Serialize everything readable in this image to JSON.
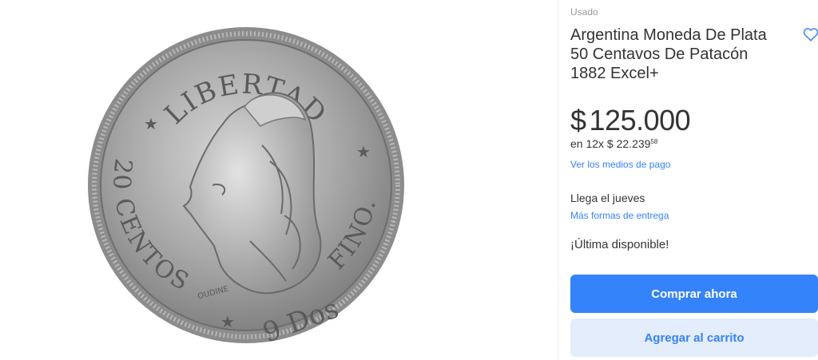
{
  "product": {
    "condition": "Usado",
    "title": "Argentina Moneda De Plata 50 Centavos De Patacón 1882 Excel+",
    "favorite_icon": "heart-outline-icon",
    "price": {
      "currency": "$",
      "amount": "125.000"
    },
    "installments": {
      "prefix": "en 12x $ ",
      "amount": "22.239",
      "cents": "58"
    },
    "payment_link": "Ver los medios de pago",
    "delivery": "Llega el jueves",
    "delivery_link": "Más formas de entrega",
    "stock": "¡Última disponible!",
    "buy_button": "Comprar ahora",
    "cart_button": "Agregar al carrito"
  },
  "coin": {
    "top_legend": "LIBERTAD",
    "left_legend": "20 CENTOS",
    "right_legend": "FINO.",
    "denomination": "9 Dos",
    "engraver": "OUDINE"
  },
  "colors": {
    "accent": "#3483fa",
    "accent_light": "#e3edfb",
    "text": "#333333",
    "muted": "#999999"
  }
}
